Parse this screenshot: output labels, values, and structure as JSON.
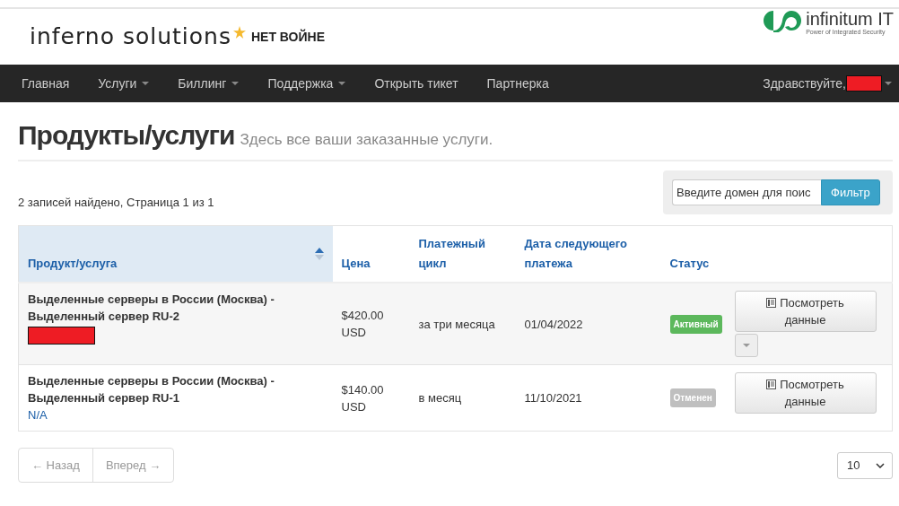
{
  "header": {
    "logo": "inferno solutions",
    "slogan": "НЕТ ВОЙНЕ",
    "partner_logo": "infinitum IT",
    "partner_tagline": "Power of Integrated Security"
  },
  "nav": {
    "items": [
      {
        "label": "Главная",
        "dropdown": false
      },
      {
        "label": "Услуги",
        "dropdown": true
      },
      {
        "label": "Биллинг",
        "dropdown": true
      },
      {
        "label": "Поддержка",
        "dropdown": true
      },
      {
        "label": "Открыть тикет",
        "dropdown": false
      },
      {
        "label": "Партнерка",
        "dropdown": false
      }
    ],
    "greeting": "Здравствуйте,",
    "user_redacted": true
  },
  "page": {
    "title": "Продукты/услуги",
    "subtitle": "Здесь все ваши заказанные услуги."
  },
  "records_info": "2 записей найдено, Страница 1 из 1",
  "filter": {
    "placeholder": "Введите домен для поис",
    "button": "Фильтр"
  },
  "table": {
    "columns": [
      {
        "label": "Продукт/услуга",
        "sorted": true
      },
      {
        "label": "Цена",
        "sorted": false
      },
      {
        "label": "Платежный цикл",
        "sorted": false
      },
      {
        "label": "Дата следующего платежа",
        "sorted": false
      },
      {
        "label": "Статус",
        "sorted": false
      }
    ],
    "rows": [
      {
        "product": "Выделенные серверы в России (Москва) - Выделенный сервер RU-2",
        "redacted": true,
        "price": "$420.00 USD",
        "cycle": "за три месяца",
        "next_due": "01/04/2022",
        "status": "Активный",
        "color": "#5cb85c",
        "button": "Посмотреть данные",
        "has_menu": true
      },
      {
        "product": "Выделенные серверы в России (Москва) - Выделенный сервер RU-1",
        "redacted": false,
        "domain": "N/A",
        "price": "$140.00 USD",
        "cycle": "в месяц",
        "next_due": "11/10/2021",
        "status": "Отменен",
        "color": "#bfbfbf",
        "button": "Посмотреть данные",
        "has_menu": false
      }
    ]
  },
  "pagination": {
    "prev": "← Назад",
    "next": "Вперед →",
    "per_page": "10"
  }
}
